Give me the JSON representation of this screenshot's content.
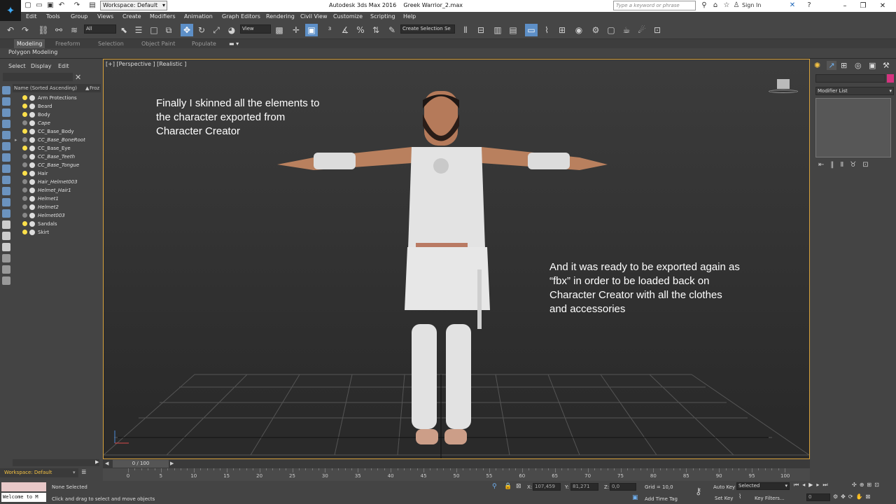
{
  "app": {
    "title": "Autodesk 3ds Max 2016",
    "file": "Greek Warrior_2.max",
    "logo": "MAX",
    "workspace": "Workspace: Default",
    "search_placeholder": "Type a keyword or phrase",
    "sign_in": "Sign In"
  },
  "menu": [
    "Edit",
    "Tools",
    "Group",
    "Views",
    "Create",
    "Modifiers",
    "Animation",
    "Graph Editors",
    "Rendering",
    "Civil View",
    "Customize",
    "Scripting",
    "Help"
  ],
  "toolbar": {
    "selection_filter": "All",
    "ref_coord": "View",
    "named_selection": "Create Selection Se"
  },
  "ribbon": {
    "tabs": [
      "Modeling",
      "Freeform",
      "Selection",
      "Object Paint",
      "Populate"
    ],
    "sub": "Polygon Modeling"
  },
  "scene_explorer": {
    "tabs": [
      "Select",
      "Display",
      "Edit"
    ],
    "col_name": "Name (Sorted Ascending)",
    "col_froz": "Froz",
    "items": [
      {
        "name": "Arm Protections",
        "light": true,
        "italic": false
      },
      {
        "name": "Beard",
        "light": true,
        "italic": false
      },
      {
        "name": "Body",
        "light": true,
        "italic": false
      },
      {
        "name": "Cape",
        "light": false,
        "italic": true
      },
      {
        "name": "CC_Base_Body",
        "light": true,
        "italic": false
      },
      {
        "name": "CC_Base_BoneRoot",
        "light": false,
        "italic": true
      },
      {
        "name": "CC_Base_Eye",
        "light": true,
        "italic": false
      },
      {
        "name": "CC_Base_Teeth",
        "light": false,
        "italic": true
      },
      {
        "name": "CC_Base_Tongue",
        "light": false,
        "italic": true
      },
      {
        "name": "Hair",
        "light": true,
        "italic": false
      },
      {
        "name": "Hair_Helmet003",
        "light": false,
        "italic": true
      },
      {
        "name": "Helmet_Hair1",
        "light": false,
        "italic": true
      },
      {
        "name": "Helmet1",
        "light": false,
        "italic": true
      },
      {
        "name": "Helmet2",
        "light": false,
        "italic": true
      },
      {
        "name": "Helmet003",
        "light": false,
        "italic": true
      },
      {
        "name": "Sandals",
        "light": true,
        "italic": false
      },
      {
        "name": "Skirt",
        "light": true,
        "italic": false
      }
    ],
    "workspace": "Workspace: Default"
  },
  "viewport": {
    "label": "[+] [Perspective ] [Realistic ]",
    "annotation1": [
      "Finally I skinned all the elements to",
      "the character exported from",
      "Character Creator"
    ],
    "annotation2": [
      "And it was ready to be exported again as",
      "“fbx” in order to be loaded back on",
      "Character Creator with all the clothes",
      "and accessories"
    ]
  },
  "command_panel": {
    "modifier_list": "Modifier List"
  },
  "timeline": {
    "frame": "0 / 100",
    "ticks": [
      "0",
      "5",
      "10",
      "15",
      "20",
      "25",
      "30",
      "35",
      "40",
      "45",
      "50",
      "55",
      "60",
      "65",
      "70",
      "75",
      "80",
      "85",
      "90",
      "95",
      "100"
    ]
  },
  "status": {
    "maxscript": "Welcome to M",
    "selection": "None Selected",
    "prompt": "Click and drag to select and move objects",
    "x_label": "X:",
    "x": "107,459",
    "y_label": "Y:",
    "y": "81,271",
    "z_label": "Z:",
    "z": "0,0",
    "grid": "Grid = 10,0",
    "add_time_tag": "Add Time Tag",
    "auto_key": "Auto Key",
    "set_key": "Set Key",
    "key_mode": "Selected",
    "key_filters": "Key Filters...",
    "frame": "0"
  },
  "colors": {
    "viewport_border": "#d7a13b",
    "active_tool": "#5d8fc7",
    "light_on": "#fde04a"
  }
}
